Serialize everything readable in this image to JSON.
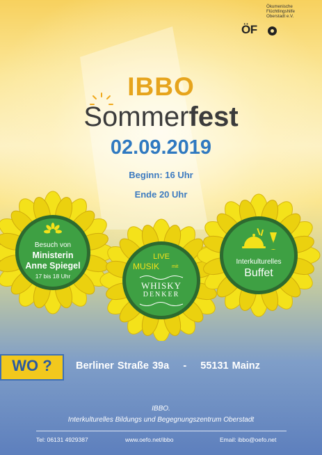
{
  "logo": {
    "caption_lines": [
      "Ökumenische",
      "Flüchtlingshilfe",
      "Oberstadt e.V."
    ],
    "mark": "ÖF"
  },
  "title": {
    "line1": "IBBO",
    "line2a": "Somm",
    "line2b": "er",
    "line2c": "fest"
  },
  "date": "02.09.2019",
  "times": {
    "start": "Beginn: 16 Uhr",
    "end": "Ende 20 Uhr"
  },
  "flowers": {
    "left": {
      "line1": "Besuch von",
      "line2": "Ministerin",
      "line3": "Anne Spiegel",
      "line4": "17 bis 18 Uhr"
    },
    "center": {
      "live": "LIVE",
      "musik": "MUSIK",
      "mit": "mit",
      "band1": "WHISKY",
      "band2": "DENKER"
    },
    "right": {
      "line1": "Interkulturelles",
      "line2": "Buffet"
    }
  },
  "location": {
    "label": "WO ?",
    "street": "Berliner Straße 39a",
    "separator": "-",
    "city": "55131 Mainz"
  },
  "organizer": {
    "name": "IBBO.",
    "full": "Interkulturelles Bildungs und Begegnungszentrum Oberstadt"
  },
  "footer": {
    "phone": "Tel: 06131 4929387",
    "web": "www.oefo.net/ibbo",
    "email": "Email: ibbo@oefo.net"
  },
  "colors": {
    "title_orange": "#e6a41c",
    "date_blue": "#2f79c0",
    "disk_green": "#3ea043",
    "petal_yellow": "#f4e21a",
    "wo_yellow": "#f2c81d"
  }
}
